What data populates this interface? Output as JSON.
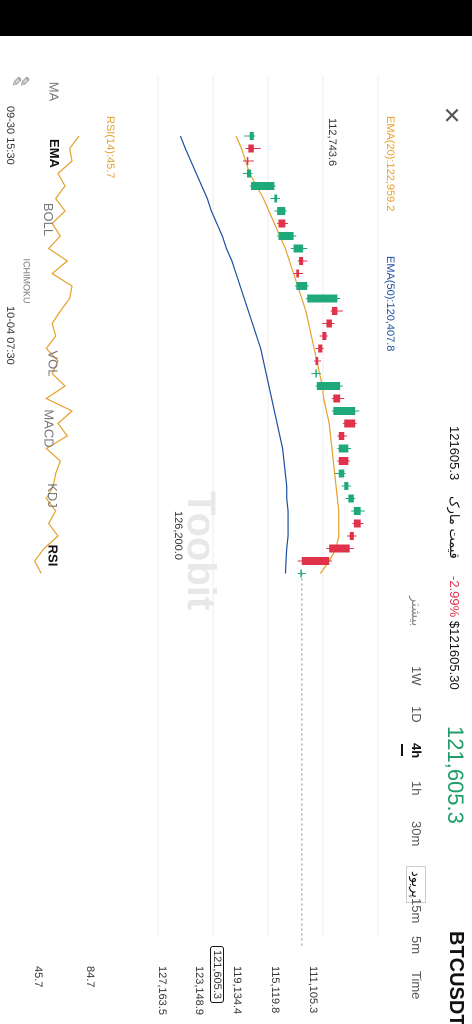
{
  "header": {
    "symbol": "BTCUSDT",
    "last_price_big": "121,605.3",
    "price_usd": "$121605.30",
    "change_pct": "-2.99%",
    "mark_label": "قیمت مارک",
    "mark_price": "121605.3",
    "interval_label": "پریود"
  },
  "timeframes": [
    "Time",
    "5m",
    "15m",
    "30m",
    "1h",
    "4h",
    "1D",
    "1W"
  ],
  "active_timeframe": "4h",
  "more_label": "بیشتر",
  "indicators": [
    "MA",
    "EMA",
    "BOLL",
    "ICHIMOKU",
    "VOL",
    "MACD",
    "KDJ",
    "RSI"
  ],
  "active_indicators": [
    "EMA",
    "RSI"
  ],
  "legend": {
    "ema20": "EMA(20):122,959.2",
    "ema50": "EMA(50):120,407.8",
    "rsi": "RSI(14):45.7"
  },
  "annotations": {
    "high_label": "126,200.0",
    "low_label": "112,743.6",
    "current_price_tag": "121,605.3"
  },
  "y_ticks": [
    "127,163.5",
    "123,148.9",
    "119,134.4",
    "115,119.8",
    "111,105.3"
  ],
  "rsi_ticks": [
    "84.7",
    "45.7"
  ],
  "time_labels": [
    "09-30 15:30",
    "10-04 07:30"
  ],
  "watermark": "Toobit",
  "colors": {
    "up": "#1fa97a",
    "down": "#e0324b",
    "ema20": "#e6a02b",
    "ema50": "#1d4fa0",
    "rsi": "#e6a02b"
  },
  "chart_data": {
    "type": "candlestick",
    "ylim": [
      111105.3,
      127163.5
    ],
    "candles": [
      {
        "o": 117800,
        "h": 118200,
        "l": 117400,
        "c": 118100
      },
      {
        "o": 118100,
        "h": 118600,
        "l": 117500,
        "c": 117700
      },
      {
        "o": 117700,
        "h": 118100,
        "l": 117300,
        "c": 117600
      },
      {
        "o": 117600,
        "h": 118000,
        "l": 117300,
        "c": 117900
      },
      {
        "o": 117900,
        "h": 119700,
        "l": 117800,
        "c": 119600
      },
      {
        "o": 119600,
        "h": 120000,
        "l": 119300,
        "c": 119800
      },
      {
        "o": 119800,
        "h": 120500,
        "l": 119600,
        "c": 120400
      },
      {
        "o": 120400,
        "h": 120600,
        "l": 119800,
        "c": 119900
      },
      {
        "o": 119900,
        "h": 121200,
        "l": 119800,
        "c": 121000
      },
      {
        "o": 121000,
        "h": 122000,
        "l": 120800,
        "c": 121700
      },
      {
        "o": 121700,
        "h": 122000,
        "l": 121300,
        "c": 121400
      },
      {
        "o": 121400,
        "h": 121700,
        "l": 121000,
        "c": 121200
      },
      {
        "o": 121200,
        "h": 122100,
        "l": 121100,
        "c": 122000
      },
      {
        "o": 122000,
        "h": 124400,
        "l": 121900,
        "c": 124200
      },
      {
        "o": 124200,
        "h": 124600,
        "l": 123700,
        "c": 123800
      },
      {
        "o": 123800,
        "h": 124000,
        "l": 123100,
        "c": 123400
      },
      {
        "o": 123400,
        "h": 123500,
        "l": 122900,
        "c": 123100
      },
      {
        "o": 123100,
        "h": 123200,
        "l": 122600,
        "c": 122800
      },
      {
        "o": 122800,
        "h": 123000,
        "l": 122500,
        "c": 122600
      },
      {
        "o": 122600,
        "h": 123000,
        "l": 122300,
        "c": 122700
      },
      {
        "o": 122700,
        "h": 124600,
        "l": 122600,
        "c": 124400
      },
      {
        "o": 124400,
        "h": 124700,
        "l": 123800,
        "c": 123900
      },
      {
        "o": 123900,
        "h": 125800,
        "l": 123800,
        "c": 125500
      },
      {
        "o": 125500,
        "h": 125600,
        "l": 124600,
        "c": 124700
      },
      {
        "o": 124700,
        "h": 124900,
        "l": 124200,
        "c": 124300
      },
      {
        "o": 124300,
        "h": 125200,
        "l": 124200,
        "c": 125000
      },
      {
        "o": 125000,
        "h": 125100,
        "l": 124200,
        "c": 124300
      },
      {
        "o": 124300,
        "h": 124800,
        "l": 124000,
        "c": 124700
      },
      {
        "o": 124700,
        "h": 125200,
        "l": 124500,
        "c": 125000
      },
      {
        "o": 125000,
        "h": 125500,
        "l": 124800,
        "c": 125400
      },
      {
        "o": 125400,
        "h": 126200,
        "l": 125200,
        "c": 125900
      },
      {
        "o": 125900,
        "h": 126100,
        "l": 125300,
        "c": 125400
      },
      {
        "o": 125400,
        "h": 125600,
        "l": 124900,
        "c": 125100
      },
      {
        "o": 125100,
        "h": 125400,
        "l": 123400,
        "c": 123600
      },
      {
        "o": 123600,
        "h": 123800,
        "l": 121300,
        "c": 121600
      },
      {
        "o": 121600,
        "h": 121900,
        "l": 121300,
        "c": 121605.3
      }
    ],
    "ema20": [
      116800,
      117200,
      117500,
      117800,
      118300,
      118800,
      119200,
      119600,
      120000,
      120400,
      120700,
      121000,
      121300,
      121600,
      121900,
      122100,
      122300,
      122500,
      122700,
      122900,
      123100,
      123200,
      123400,
      123600,
      123700,
      123800,
      123900,
      124000,
      124100,
      124200,
      124300,
      124300,
      124300,
      124100,
      123600,
      122959.2
    ],
    "ema50": [
      112743.6,
      113100,
      113500,
      113900,
      114300,
      114700,
      115000,
      115400,
      115800,
      116100,
      116500,
      116800,
      117100,
      117400,
      117700,
      118000,
      118300,
      118600,
      118800,
      119000,
      119200,
      119400,
      119600,
      119800,
      120000,
      120200,
      120300,
      120400,
      120500,
      120500,
      120600,
      120600,
      120600,
      120500,
      120450,
      120407.8
    ],
    "rsi": [
      78,
      70,
      72,
      60,
      66,
      58,
      66,
      55,
      62,
      52,
      68,
      55,
      72,
      70,
      62,
      55,
      58,
      50,
      60,
      55,
      66,
      50,
      72,
      60,
      68,
      50,
      62,
      58,
      56,
      50,
      58,
      52,
      60,
      48,
      40,
      45.7
    ]
  }
}
